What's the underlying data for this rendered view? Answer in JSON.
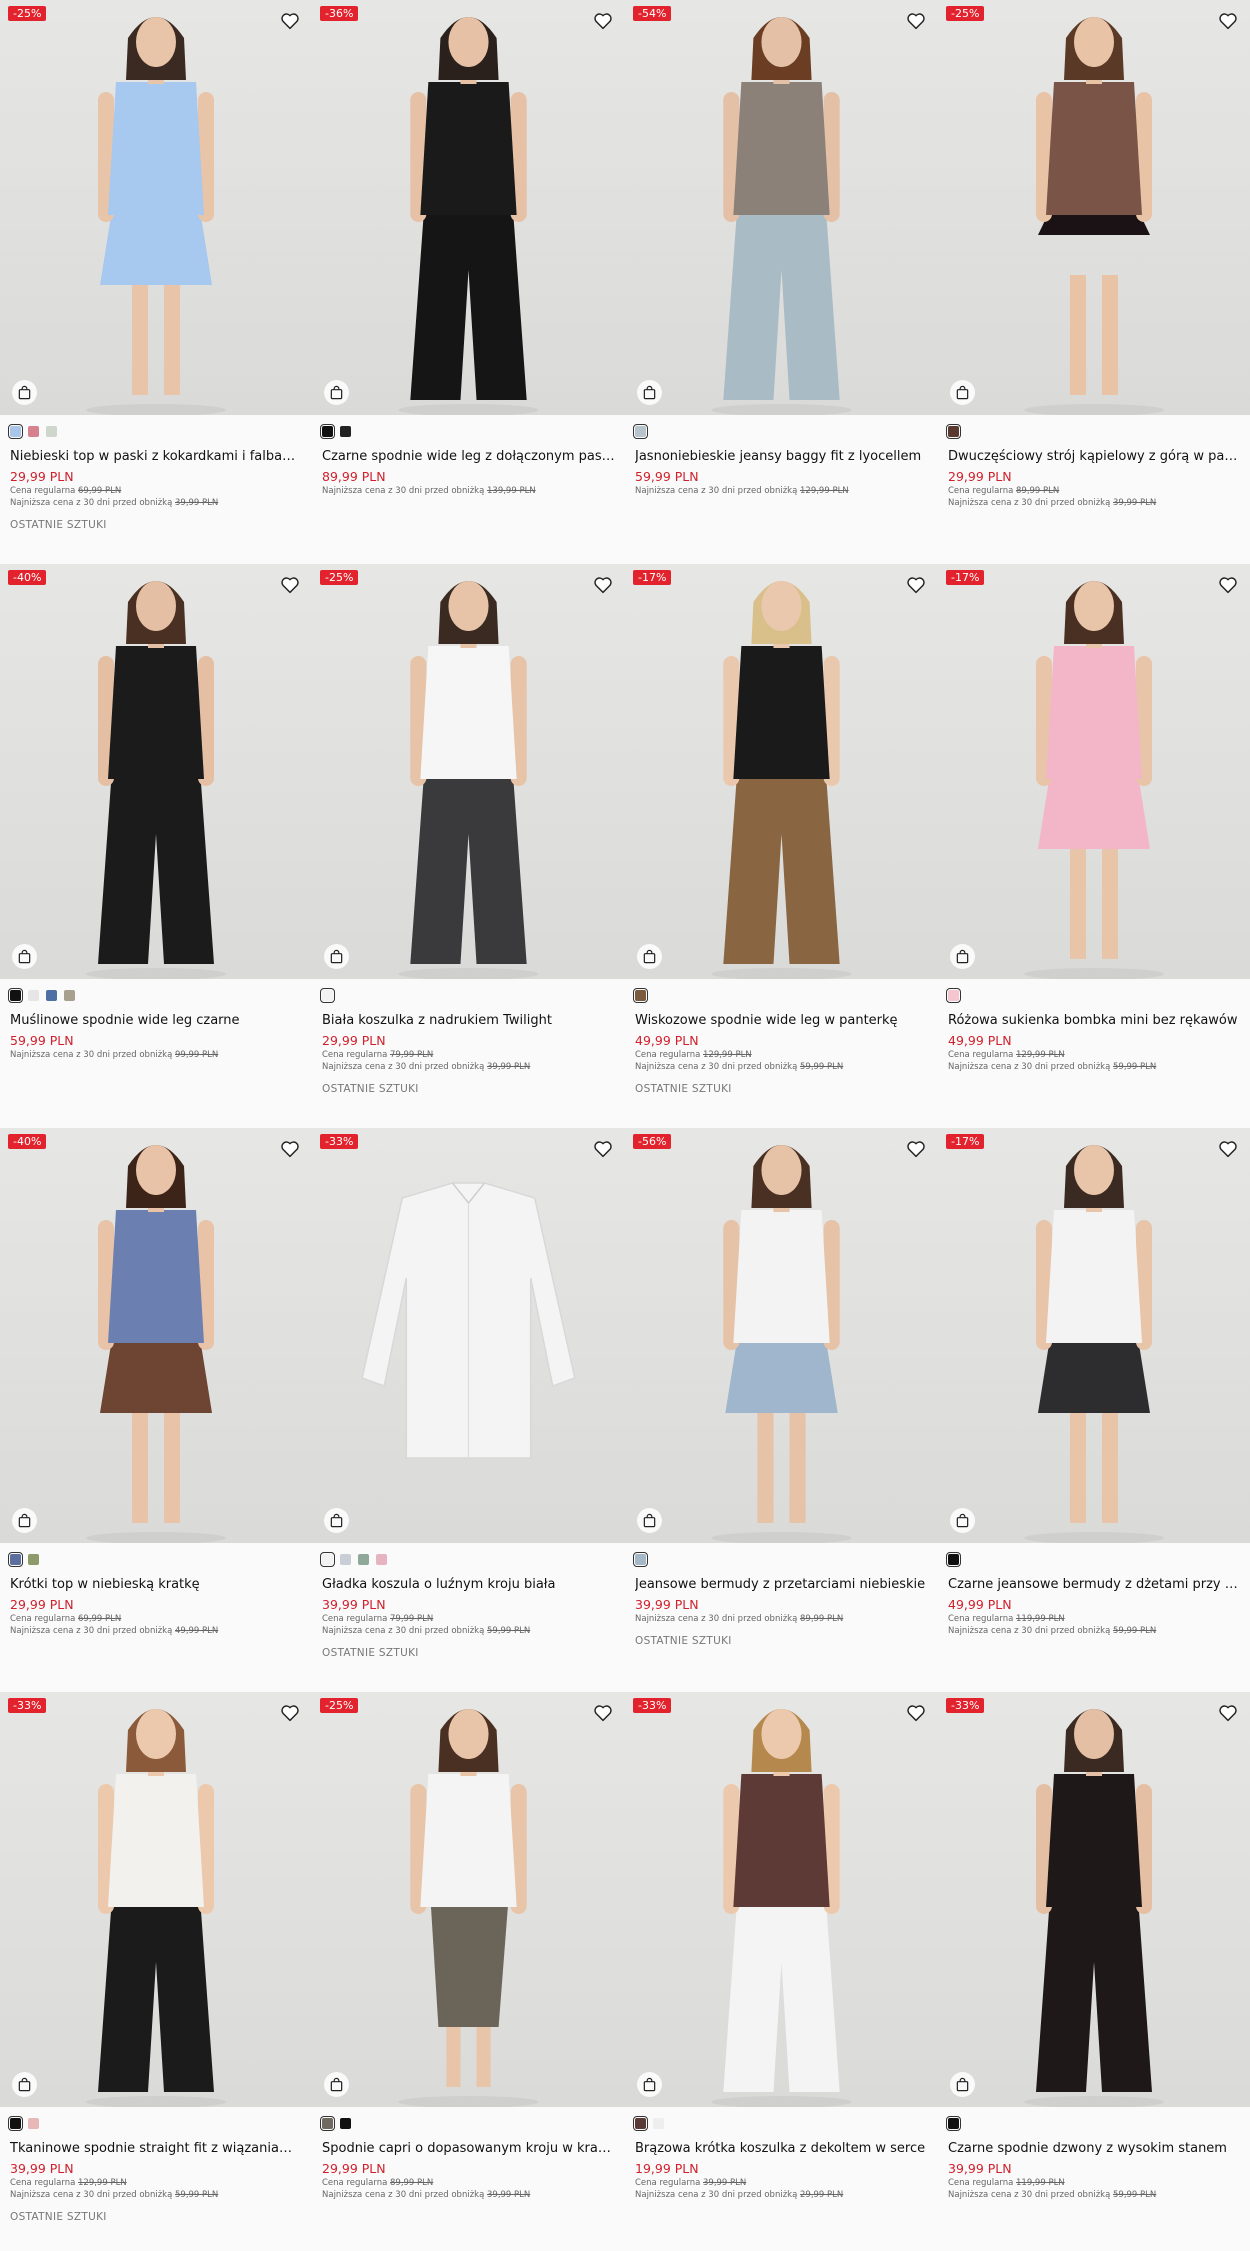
{
  "products": [
    {
      "badge": "-25%",
      "name": "Niebieski top w paski z kokardkami i falbanką",
      "price": "29,99 PLN",
      "regular_label": "Cena regularna",
      "regular_price": "69,99 PLN",
      "lowest_label": "Najniższa cena z 30 dni przed obniżką",
      "lowest_price": "39,99 PLN",
      "last_items": "OSTATNIE SZTUKI",
      "swatches": [
        "#a9c6e8",
        "#d6828e",
        "#cfd6cc"
      ],
      "top": "#a7c8ef",
      "bottom": "#a7c8ef",
      "skin": "#e8c4a8",
      "hair": "#3a2a22"
    },
    {
      "badge": "-36%",
      "name": "Czarne spodnie wide leg z dołączonym paskiem",
      "price": "89,99 PLN",
      "regular_label": "",
      "regular_price": "",
      "lowest_label": "Najniższa cena z 30 dni przed obniżką",
      "lowest_price": "139,99 PLN",
      "last_items": "",
      "swatches": [
        "#111111",
        "#222222"
      ],
      "top": "#1a1a1a",
      "bottom": "#151515",
      "skin": "#e6c1a5",
      "hair": "#2b211c"
    },
    {
      "badge": "-54%",
      "name": "Jasnoniebieskie jeansy baggy fit z lyocellem",
      "price": "59,99 PLN",
      "regular_label": "",
      "regular_price": "",
      "lowest_label": "Najniższa cena z 30 dni przed obniżką",
      "lowest_price": "129,99 PLN",
      "last_items": "",
      "swatches": [
        "#b8c4cc"
      ],
      "top": "#8b8178",
      "bottom": "#a9bcc6",
      "skin": "#e4c0a6",
      "hair": "#6b3e24"
    },
    {
      "badge": "-25%",
      "name": "Dwuczęściowy strój kąpielowy z górą w panterkę",
      "price": "29,99 PLN",
      "regular_label": "Cena regularna",
      "regular_price": "89,99 PLN",
      "lowest_label": "Najniższa cena z 30 dni przed obniżką",
      "lowest_price": "39,99 PLN",
      "last_items": "",
      "swatches": [
        "#5a3a2e"
      ],
      "top": "#7a5446",
      "bottom": "#1a1214",
      "skin": "#e9c3a6",
      "hair": "#5a3a26"
    },
    {
      "badge": "-40%",
      "name": "Muślinowe spodnie wide leg czarne",
      "price": "59,99 PLN",
      "regular_label": "",
      "regular_price": "",
      "lowest_label": "Najniższa cena z 30 dni przed obniżką",
      "lowest_price": "99,99 PLN",
      "last_items": "",
      "swatches": [
        "#111111",
        "#e6e6e6",
        "#4d6fa3",
        "#a8a08e"
      ],
      "top": "#1b1b1b",
      "bottom": "#1b1b1b",
      "skin": "#e4bfa3",
      "hair": "#4a3022"
    },
    {
      "badge": "-25%",
      "name": "Biała koszulka z nadrukiem Twilight",
      "price": "29,99 PLN",
      "regular_label": "Cena regularna",
      "regular_price": "79,99 PLN",
      "lowest_label": "Najniższa cena z 30 dni przed obniżką",
      "lowest_price": "39,99 PLN",
      "last_items": "OSTATNIE SZTUKI",
      "swatches": [
        "#f2f2f2"
      ],
      "top": "#f6f6f6",
      "bottom": "#3a3a3c",
      "skin": "#e7c3a8",
      "hair": "#3a2a22"
    },
    {
      "badge": "-17%",
      "name": "Wiskozowe spodnie wide leg w panterkę",
      "price": "49,99 PLN",
      "regular_label": "Cena regularna",
      "regular_price": "129,99 PLN",
      "lowest_label": "Najniższa cena z 30 dni przed obniżką",
      "lowest_price": "59,99 PLN",
      "last_items": "OSTATNIE SZTUKI",
      "swatches": [
        "#7b5a3e"
      ],
      "top": "#1a1a1a",
      "bottom": "#8a6542",
      "skin": "#eac8ad",
      "hair": "#d9c08a"
    },
    {
      "badge": "-17%",
      "name": "Różowa sukienka bombka mini bez rękawów",
      "price": "49,99 PLN",
      "regular_label": "Cena regularna",
      "regular_price": "129,99 PLN",
      "lowest_label": "Najniższa cena z 30 dni przed obniżką",
      "lowest_price": "59,99 PLN",
      "last_items": "",
      "swatches": [
        "#f5c6d0"
      ],
      "top": "#f3b6c8",
      "bottom": "#f3b6c8",
      "skin": "#e8c4a8",
      "hair": "#4a3022"
    },
    {
      "badge": "-40%",
      "name": "Krótki top w niebieską kratkę",
      "price": "29,99 PLN",
      "regular_label": "Cena regularna",
      "regular_price": "69,99 PLN",
      "lowest_label": "Najniższa cena z 30 dni przed obniżką",
      "lowest_price": "49,99 PLN",
      "last_items": "",
      "swatches": [
        "#5c6f9e",
        "#8e9a6a"
      ],
      "top": "#6b7fb0",
      "bottom": "#6e4432",
      "skin": "#e8c3a7",
      "hair": "#3d2419"
    },
    {
      "badge": "-33%",
      "name": "Gładka koszula o luźnym kroju biała",
      "price": "39,99 PLN",
      "regular_label": "Cena regularna",
      "regular_price": "79,99 PLN",
      "lowest_label": "Najniższa cena z 30 dni przed obniżką",
      "lowest_price": "59,99 PLN",
      "last_items": "OSTATNIE SZTUKI",
      "swatches": [
        "#f2f2f2",
        "#c9ced6",
        "#8fa89a",
        "#e6b3c1"
      ],
      "top": "#f4f4f4",
      "bottom": "",
      "skin": "",
      "hair": ""
    },
    {
      "badge": "-56%",
      "name": "Jeansowe bermudy z przetarciami niebieskie",
      "price": "39,99 PLN",
      "regular_label": "",
      "regular_price": "",
      "lowest_label": "Najniższa cena z 30 dni przed obniżką",
      "lowest_price": "89,99 PLN",
      "last_items": "OSTATNIE SZTUKI",
      "swatches": [
        "#a5b8c8"
      ],
      "top": "#f3f3f3",
      "bottom": "#9fb6cc",
      "skin": "#e6c2a6",
      "hair": "#4a3022"
    },
    {
      "badge": "-17%",
      "name": "Czarne jeansowe bermudy z dżetami przy kieszeniach",
      "price": "49,99 PLN",
      "regular_label": "Cena regularna",
      "regular_price": "119,99 PLN",
      "lowest_label": "Najniższa cena z 30 dni przed obniżką",
      "lowest_price": "59,99 PLN",
      "last_items": "",
      "swatches": [
        "#111111"
      ],
      "top": "#f3f3f3",
      "bottom": "#2d2d2f",
      "skin": "#e8c4a8",
      "hair": "#3a2a22"
    },
    {
      "badge": "-33%",
      "name": "Tkaninowe spodnie straight fit z wiązaniami z boku",
      "price": "39,99 PLN",
      "regular_label": "Cena regularna",
      "regular_price": "129,99 PLN",
      "lowest_label": "Najniższa cena z 30 dni przed obniżką",
      "lowest_price": "59,99 PLN",
      "last_items": "OSTATNIE SZTUKI",
      "swatches": [
        "#111111",
        "#e8b8b8"
      ],
      "top": "#f3f1ee",
      "bottom": "#1b1b1b",
      "skin": "#ecc9ad",
      "hair": "#8a5a3a"
    },
    {
      "badge": "-25%",
      "name": "Spodnie capri o dopasowanym kroju w kratkę",
      "price": "29,99 PLN",
      "regular_label": "Cena regularna",
      "regular_price": "89,99 PLN",
      "lowest_label": "Najniższa cena z 30 dni przed obniżką",
      "lowest_price": "39,99 PLN",
      "last_items": "",
      "swatches": [
        "#6f6a60",
        "#111111"
      ],
      "top": "#f4f4f4",
      "bottom": "#6b6559",
      "skin": "#e8c4a8",
      "hair": "#4a3022"
    },
    {
      "badge": "-33%",
      "name": "Brązowa krótka koszulka z dekoltem w serce",
      "price": "19,99 PLN",
      "regular_label": "Cena regularna",
      "regular_price": "39,99 PLN",
      "lowest_label": "Najniższa cena z 30 dni przed obniżką",
      "lowest_price": "29,99 PLN",
      "last_items": "",
      "swatches": [
        "#5a3a34",
        "#eeeeee"
      ],
      "top": "#5e3a36",
      "bottom": "#f4f4f4",
      "skin": "#ecc9ad",
      "hair": "#b5884e"
    },
    {
      "badge": "-33%",
      "name": "Czarne spodnie dzwony z wysokim stanem",
      "price": "39,99 PLN",
      "regular_label": "Cena regularna",
      "regular_price": "119,99 PLN",
      "lowest_label": "Najniższa cena z 30 dni przed obniżką",
      "lowest_price": "59,99 PLN",
      "last_items": "",
      "swatches": [
        "#111111"
      ],
      "top": "#1e1818",
      "bottom": "#1e1818",
      "skin": "#e4bfa3",
      "hair": "#3a2a22"
    }
  ]
}
